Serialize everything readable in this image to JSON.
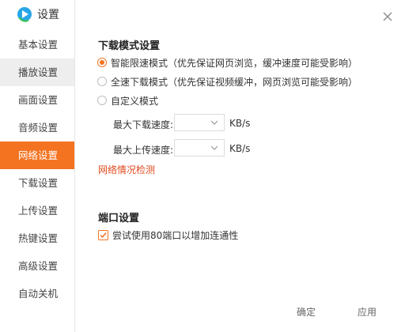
{
  "app": {
    "title": "设置",
    "accent_color": "#f47321",
    "logo_icon": "video-app-logo-icon"
  },
  "sidebar": {
    "items": [
      {
        "label": "基本设置"
      },
      {
        "label": "播放设置"
      },
      {
        "label": "画面设置"
      },
      {
        "label": "音频设置"
      },
      {
        "label": "网络设置"
      },
      {
        "label": "下载设置"
      },
      {
        "label": "上传设置"
      },
      {
        "label": "热键设置"
      },
      {
        "label": "高级设置"
      },
      {
        "label": "自动关机"
      }
    ],
    "active_label": "网络设置",
    "hovered_label": "播放设置"
  },
  "download_mode": {
    "title": "下载模式设置",
    "options": [
      {
        "label": "智能限速模式（优先保证网页浏览，缓冲速度可能受影响）",
        "checked": true
      },
      {
        "label": "全速下载模式（优先保证视频缓冲，网页浏览可能受影响）",
        "checked": false
      },
      {
        "label": "自定义模式",
        "checked": false
      }
    ],
    "max_download_label": "最大下载速度:",
    "max_download_value": "",
    "max_upload_label": "最大上传速度:",
    "max_upload_value": "",
    "unit": "KB/s",
    "network_status": "网络情况检测"
  },
  "port": {
    "title": "端口设置",
    "checkbox_label": "尝试使用80端口以增加连通性",
    "checked": true
  },
  "footer": {
    "ok_label": "确定",
    "apply_label": "应用"
  },
  "icons": {
    "close": "close-icon",
    "dropdown": "chevron-down-icon",
    "check": "check-icon"
  }
}
